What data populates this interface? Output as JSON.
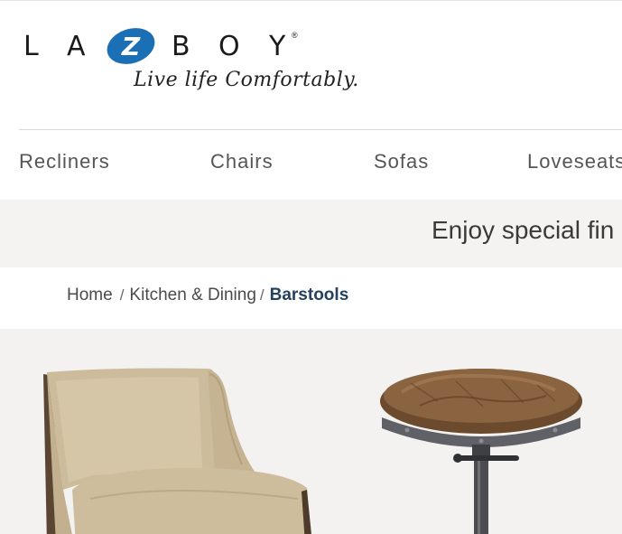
{
  "brand": {
    "letters": [
      "L",
      "A",
      "Z",
      "B",
      "O",
      "Y"
    ],
    "registered": "®",
    "tagline": "Live life Comfortably.",
    "logo_color": "#1b6fb5"
  },
  "nav": {
    "items": [
      "Recliners",
      "Chairs",
      "Sofas",
      "Loveseats"
    ]
  },
  "promo": {
    "text": "Enjoy special fin"
  },
  "breadcrumb": {
    "home": "Home",
    "separator": "/",
    "kitchen": "Kitchen & Dining",
    "current": "Barstools"
  },
  "products": [
    {
      "name": "upholstered-swivel-barstool",
      "icon": "chair-image"
    },
    {
      "name": "leather-adjustable-stool",
      "icon": "stool-image"
    }
  ],
  "colors": {
    "promo_bg": "#f4f3f1",
    "product_bg": "#f3f2f0",
    "breadcrumb_current": "#24415e"
  }
}
